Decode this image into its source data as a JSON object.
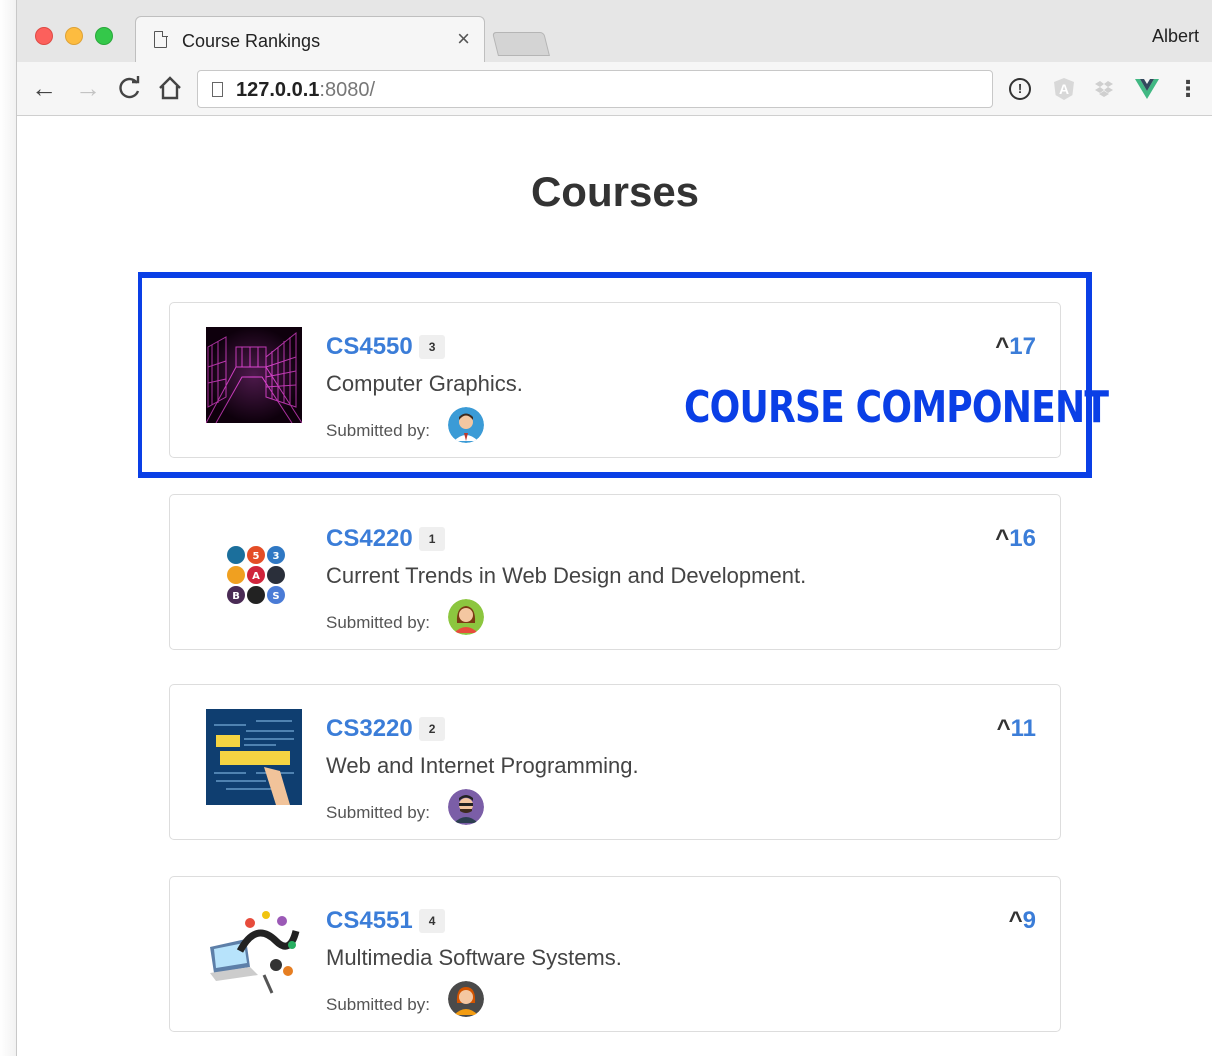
{
  "browser": {
    "tab_title": "Course Rankings",
    "tab_close": "×",
    "profile_name": "Albert",
    "url_host": "127.0.0.1",
    "url_rest": ":8080/",
    "nav": {
      "back": "←",
      "forward": "→",
      "reload": "C",
      "home": "⌂"
    },
    "extensions": {
      "info": "!",
      "angular": "A",
      "dropbox": "⇟",
      "menu": "⋮"
    }
  },
  "page": {
    "title": "Courses"
  },
  "courses": [
    {
      "code": "CS4550",
      "rank": "3",
      "name": "Computer Graphics.",
      "submitted_label": "Submitted by:",
      "votes": "17",
      "caret": "^"
    },
    {
      "code": "CS4220",
      "rank": "1",
      "name": "Current Trends in Web Design and Development.",
      "submitted_label": "Submitted by:",
      "votes": "16",
      "caret": "^"
    },
    {
      "code": "CS3220",
      "rank": "2",
      "name": "Web and Internet Programming.",
      "submitted_label": "Submitted by:",
      "votes": "11",
      "caret": "^"
    },
    {
      "code": "CS4551",
      "rank": "4",
      "name": "Multimedia Software Systems.",
      "submitted_label": "Submitted by:",
      "votes": "9",
      "caret": "^"
    }
  ],
  "annotation": {
    "label": "COURSE COMPONENT",
    "color": "#0a3fe6"
  },
  "colors": {
    "link": "#3b7dd8",
    "title": "#333333"
  }
}
